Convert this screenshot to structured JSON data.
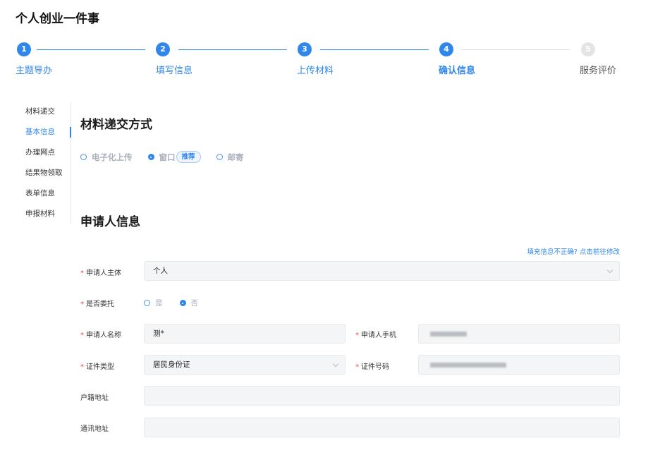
{
  "page_title": "个人创业一件事",
  "steps": [
    {
      "number": "1",
      "label": "主题导办",
      "state": "done"
    },
    {
      "number": "2",
      "label": "填写信息",
      "state": "done"
    },
    {
      "number": "3",
      "label": "上传材料",
      "state": "done"
    },
    {
      "number": "4",
      "label": "确认信息",
      "state": "active"
    },
    {
      "number": "5",
      "label": "服务评价",
      "state": "pending"
    }
  ],
  "side_nav": [
    "材料递交",
    "基本信息",
    "办理网点",
    "结果物领取",
    "表单信息",
    "申报材料"
  ],
  "side_nav_active": "基本信息",
  "submission": {
    "title": "材料递交方式",
    "options": [
      "电子化上传",
      "窗口",
      "邮寄"
    ],
    "selected": "窗口",
    "recommend_tag": "推荐"
  },
  "applicant": {
    "title": "申请人信息",
    "edit_link": "填充信息不正确? 点击前往修改",
    "subject_label": "申请人主体",
    "subject_value": "个人",
    "entrust_label": "是否委托",
    "entrust_options": [
      "是",
      "否"
    ],
    "entrust_selected": "否",
    "name_label": "申请人名称",
    "name_value": "测*",
    "phone_label": "申请人手机",
    "id_type_label": "证件类型",
    "id_type_value": "居民身份证",
    "id_number_label": "证件号码",
    "household_label": "户籍地址",
    "household_value": "",
    "contact_label": "通讯地址",
    "contact_value": ""
  },
  "colors": {
    "accent": "#2f86eb",
    "required": "#e8463a",
    "pending_step": "#e4e4e4"
  }
}
